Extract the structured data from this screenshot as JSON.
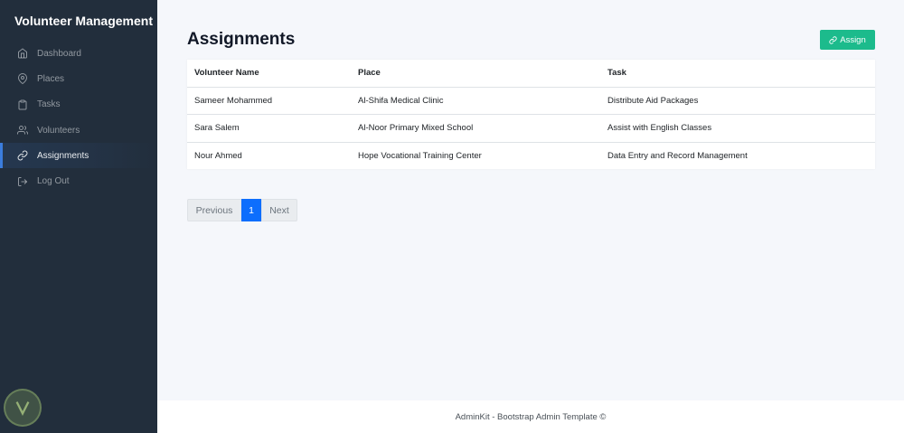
{
  "sidebar": {
    "brand": "Volunteer Management",
    "items": [
      {
        "label": "Dashboard",
        "icon": "home-icon"
      },
      {
        "label": "Places",
        "icon": "map-pin-icon"
      },
      {
        "label": "Tasks",
        "icon": "clipboard-icon"
      },
      {
        "label": "Volunteers",
        "icon": "users-icon"
      },
      {
        "label": "Assignments",
        "icon": "link-icon",
        "active": true
      },
      {
        "label": "Log Out",
        "icon": "log-out-icon"
      }
    ]
  },
  "main": {
    "title": "Assignments",
    "assign_button": "Assign",
    "table": {
      "headers": [
        "Volunteer Name",
        "Place",
        "Task"
      ],
      "rows": [
        [
          "Sameer Mohammed",
          "Al-Shifa Medical Clinic",
          "Distribute Aid Packages"
        ],
        [
          "Sara Salem",
          "Al-Noor Primary Mixed School",
          "Assist with English Classes"
        ],
        [
          "Nour Ahmed",
          "Hope Vocational Training Center",
          "Data Entry and Record Management"
        ]
      ]
    },
    "pagination": {
      "previous": "Previous",
      "current": "1",
      "next": "Next"
    }
  },
  "footer": {
    "text": "AdminKit - Bootstrap Admin Template ©"
  },
  "colors": {
    "sidebar_bg": "#222e3c",
    "accent": "#3b7ddd",
    "assign_button": "#1cbb8c",
    "page_active": "#0d6efd"
  }
}
